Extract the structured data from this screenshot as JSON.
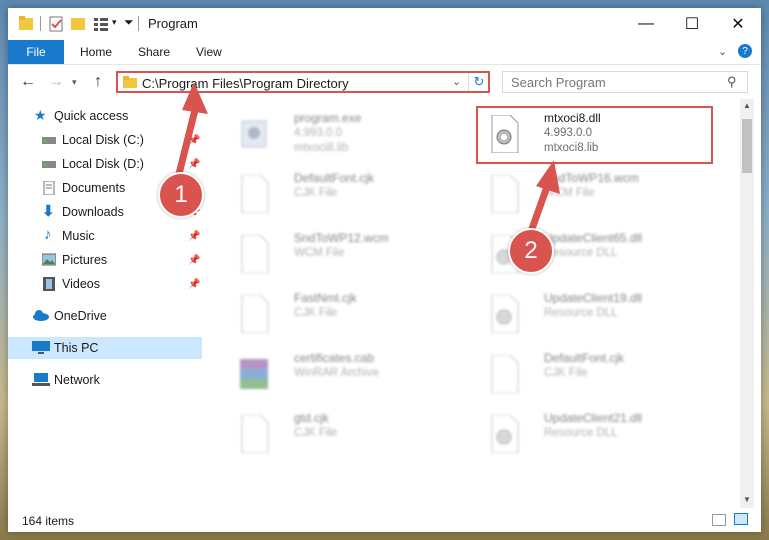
{
  "window": {
    "title": "Program"
  },
  "ribbon": {
    "file_label": "File",
    "tabs": [
      "Home",
      "Share",
      "View"
    ]
  },
  "address": {
    "path": "C:\\Program Files\\Program Directory",
    "search_placeholder": "Search Program"
  },
  "sidebar": {
    "items": [
      {
        "label": "Quick access",
        "icon": "star-icon",
        "pinned": false
      },
      {
        "label": "Local Disk (C:)",
        "icon": "drive-icon",
        "pinned": true
      },
      {
        "label": "Local Disk (D:)",
        "icon": "drive-icon",
        "pinned": true
      },
      {
        "label": "Documents",
        "icon": "documents-icon",
        "pinned": true
      },
      {
        "label": "Downloads",
        "icon": "download-icon",
        "pinned": true
      },
      {
        "label": "Music",
        "icon": "music-icon",
        "pinned": true
      },
      {
        "label": "Pictures",
        "icon": "pictures-icon",
        "pinned": true
      },
      {
        "label": "Videos",
        "icon": "videos-icon",
        "pinned": true
      },
      {
        "label": "OneDrive",
        "icon": "cloud-icon",
        "pinned": false
      },
      {
        "label": "This PC",
        "icon": "computer-icon",
        "pinned": false,
        "selected": true
      },
      {
        "label": "Network",
        "icon": "network-icon",
        "pinned": false
      }
    ]
  },
  "files": [
    {
      "name": "program.exe",
      "line2": "4.993.0.0",
      "line3": "mtxoci8.lib",
      "icon": "exe-icon"
    },
    {
      "name": "mtxoci8.dll",
      "line2": "4.993.0.0",
      "line3": "mtxoci8.lib",
      "icon": "dll-gear-icon"
    },
    {
      "name": "DefaultFont.cjk",
      "line2": "CJK File",
      "icon": "blank-file-icon"
    },
    {
      "name": "SndToWP16.wcm",
      "line2": "WCM File",
      "icon": "blank-file-icon"
    },
    {
      "name": "SndToWP12.wcm",
      "line2": "WCM File",
      "icon": "blank-file-icon"
    },
    {
      "name": "UpdateClient65.dll",
      "line2": "Resource DLL",
      "icon": "dll-gear-icon"
    },
    {
      "name": "FastNml.cjk",
      "line2": "CJK File",
      "icon": "blank-file-icon"
    },
    {
      "name": "UpdateClient19.dll",
      "line2": "Resource DLL",
      "icon": "dll-gear-icon"
    },
    {
      "name": "certificates.cab",
      "line2": "WinRAR Archive",
      "icon": "archive-icon"
    },
    {
      "name": "DefaultFont.cjk",
      "line2": "CJK File",
      "icon": "blank-file-icon"
    },
    {
      "name": "gtd.cjk",
      "line2": "CJK File",
      "icon": "blank-file-icon"
    },
    {
      "name": "UpdateClient21.dll",
      "line2": "Resource DLL",
      "icon": "dll-gear-icon"
    }
  ],
  "annotations": {
    "step1": "1",
    "step2": "2",
    "color": "#d9534f"
  },
  "status": {
    "item_count": "164 items"
  }
}
